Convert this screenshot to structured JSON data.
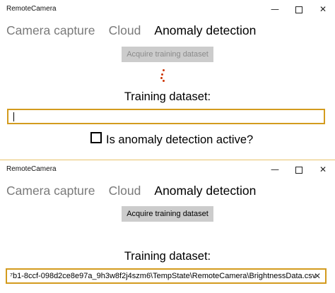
{
  "window1": {
    "title": "RemoteCamera",
    "caption": {
      "minimize": "—",
      "close": "✕"
    },
    "tabs": [
      {
        "label": "Camera capture"
      },
      {
        "label": "Cloud"
      },
      {
        "label": "Anomaly detection"
      }
    ],
    "acquire_button": "Acquire training dataset",
    "training_label": "Training dataset:",
    "training_value": "",
    "checkbox_label": "Is anomaly detection active?",
    "checkbox_checked": false
  },
  "window2": {
    "title": "RemoteCamera",
    "caption": {
      "minimize": "—",
      "close": "✕"
    },
    "tabs": [
      {
        "label": "Camera capture"
      },
      {
        "label": "Cloud"
      },
      {
        "label": "Anomaly detection"
      }
    ],
    "acquire_button": "Acquire training dataset",
    "training_label": "Training dataset:",
    "training_value": "⁷b1-8ccf-098d2ce8e97a_9h3w8f2j4szm6\\TempState\\RemoteCamera\\BrightnessData.csv",
    "clear_icon": "✕"
  },
  "colors": {
    "accent": "#d39b1e",
    "spinner": "#cc3300",
    "button_bg": "#cccccc"
  }
}
